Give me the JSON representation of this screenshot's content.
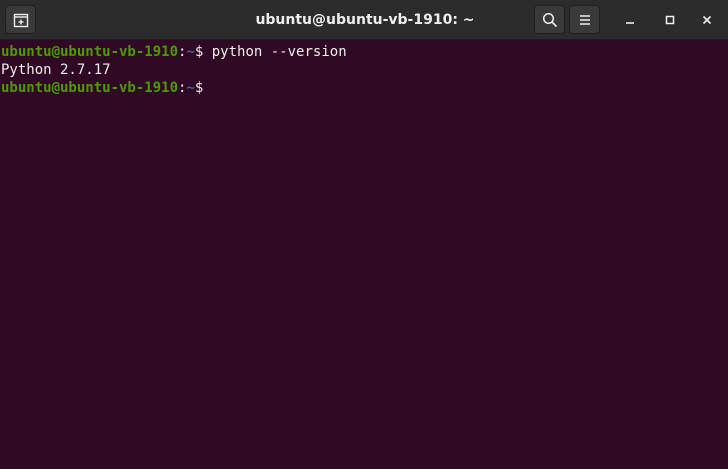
{
  "window": {
    "title": "ubuntu@ubuntu-vb-1910: ~"
  },
  "headerbar": {
    "new_tab_icon": "new-tab-icon",
    "search_icon": "search-icon",
    "menu_icon": "hamburger-menu-icon",
    "minimize_icon": "minimize-icon",
    "maximize_icon": "maximize-icon",
    "close_icon": "close-icon"
  },
  "colors": {
    "terminal_bg": "#300a24",
    "headerbar_bg": "#2c2c2c",
    "prompt_user": "#4e9a06",
    "prompt_path": "#3465a4",
    "text": "#eeeeec"
  },
  "terminal": {
    "lines": [
      {
        "user_host": "ubuntu@ubuntu-vb-1910",
        "colon": ":",
        "path": "~",
        "prompt_symbol": "$",
        "command": " python --version"
      },
      {
        "output": "Python 2.7.17"
      },
      {
        "user_host": "ubuntu@ubuntu-vb-1910",
        "colon": ":",
        "path": "~",
        "prompt_symbol": "$",
        "command": ""
      }
    ]
  }
}
